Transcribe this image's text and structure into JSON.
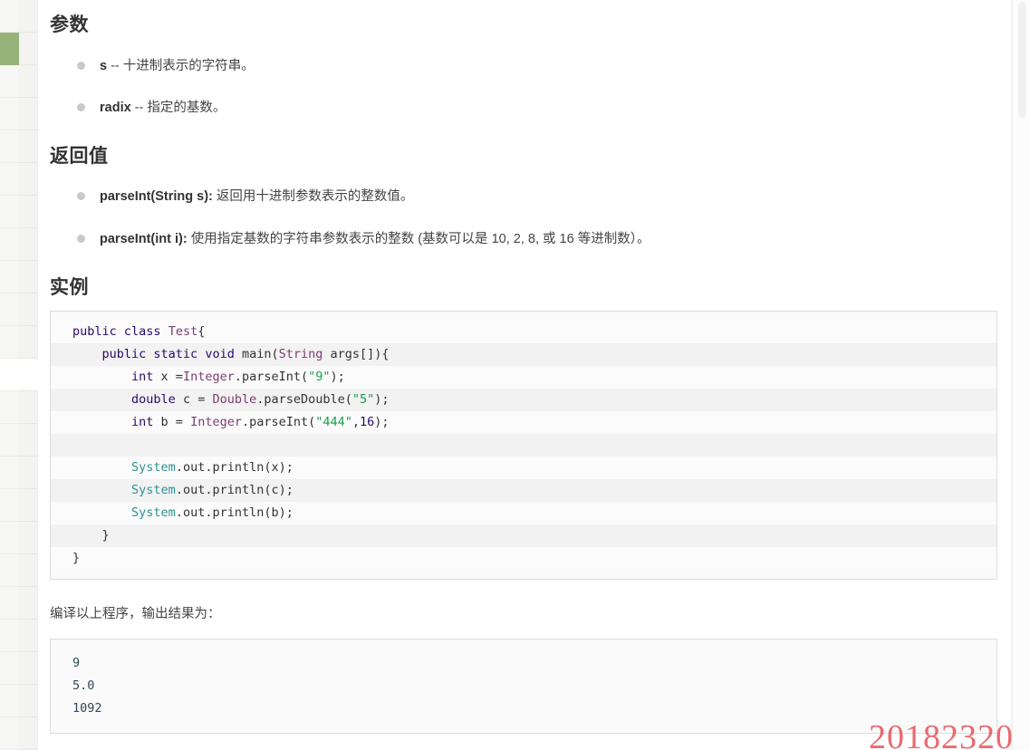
{
  "sidebar": {
    "rail_items": [
      {
        "id": "rail-0",
        "state": "normal"
      },
      {
        "id": "rail-1",
        "state": "active"
      },
      {
        "id": "rail-2",
        "state": "normal"
      },
      {
        "id": "rail-3",
        "state": "normal"
      },
      {
        "id": "rail-4",
        "state": "normal"
      },
      {
        "id": "rail-5",
        "state": "normal"
      },
      {
        "id": "rail-6",
        "state": "normal"
      },
      {
        "id": "rail-7",
        "state": "normal"
      },
      {
        "id": "rail-8",
        "state": "normal"
      },
      {
        "id": "rail-9",
        "state": "normal"
      },
      {
        "id": "rail-10",
        "state": "normal"
      },
      {
        "id": "rail-11",
        "state": "light"
      },
      {
        "id": "rail-12",
        "state": "normal"
      },
      {
        "id": "rail-13",
        "state": "normal"
      },
      {
        "id": "rail-14",
        "state": "normal"
      },
      {
        "id": "rail-15",
        "state": "normal"
      },
      {
        "id": "rail-16",
        "state": "normal"
      },
      {
        "id": "rail-17",
        "state": "normal"
      },
      {
        "id": "rail-18",
        "state": "normal"
      },
      {
        "id": "rail-19",
        "state": "normal"
      },
      {
        "id": "rail-20",
        "state": "normal"
      },
      {
        "id": "rail-21",
        "state": "normal"
      },
      {
        "id": "rail-22",
        "state": "normal"
      }
    ],
    "active_color": "#96b37a"
  },
  "sections": {
    "params": {
      "heading": "参数",
      "items": [
        {
          "term": "s",
          "desc": " -- 十进制表示的字符串。"
        },
        {
          "term": "radix",
          "desc": " -- 指定的基数。"
        }
      ]
    },
    "returns": {
      "heading": "返回值",
      "items": [
        {
          "term": "parseInt(String s):",
          "desc": " 返回用十进制参数表示的整数值。"
        },
        {
          "term": "parseInt(int i):",
          "desc": " 使用指定基数的字符串参数表示的整数 (基数可以是 10, 2, 8, 或 16 等进制数）。"
        }
      ]
    },
    "example": {
      "heading": "实例",
      "output_intro": "编译以上程序，输出结果为："
    }
  },
  "code": {
    "language": "java",
    "lines": [
      [
        {
          "t": "public ",
          "c": "kw"
        },
        {
          "t": "class ",
          "c": "kw"
        },
        {
          "t": "Test",
          "c": "cls"
        },
        {
          "t": "{",
          "c": "plain"
        }
      ],
      [
        {
          "t": "    ",
          "c": "plain"
        },
        {
          "t": "public ",
          "c": "kw"
        },
        {
          "t": "static ",
          "c": "kw"
        },
        {
          "t": "void ",
          "c": "kw"
        },
        {
          "t": "main",
          "c": "plain"
        },
        {
          "t": "(",
          "c": "plain"
        },
        {
          "t": "String ",
          "c": "cls"
        },
        {
          "t": "args[]){",
          "c": "plain"
        }
      ],
      [
        {
          "t": "        ",
          "c": "plain"
        },
        {
          "t": "int ",
          "c": "kw"
        },
        {
          "t": "x =",
          "c": "plain"
        },
        {
          "t": "Integer",
          "c": "cls"
        },
        {
          "t": ".parseInt(",
          "c": "plain"
        },
        {
          "t": "\"9\"",
          "c": "str"
        },
        {
          "t": ");",
          "c": "plain"
        }
      ],
      [
        {
          "t": "        ",
          "c": "plain"
        },
        {
          "t": "double ",
          "c": "kw"
        },
        {
          "t": "c = ",
          "c": "plain"
        },
        {
          "t": "Double",
          "c": "cls"
        },
        {
          "t": ".parseDouble(",
          "c": "plain"
        },
        {
          "t": "\"5\"",
          "c": "str"
        },
        {
          "t": ");",
          "c": "plain"
        }
      ],
      [
        {
          "t": "        ",
          "c": "plain"
        },
        {
          "t": "int ",
          "c": "kw"
        },
        {
          "t": "b = ",
          "c": "plain"
        },
        {
          "t": "Integer",
          "c": "cls"
        },
        {
          "t": ".parseInt(",
          "c": "plain"
        },
        {
          "t": "\"444\"",
          "c": "str"
        },
        {
          "t": ",",
          "c": "plain"
        },
        {
          "t": "16",
          "c": "num"
        },
        {
          "t": ");",
          "c": "plain"
        }
      ],
      [
        {
          "t": "",
          "c": "plain"
        }
      ],
      [
        {
          "t": "        ",
          "c": "plain"
        },
        {
          "t": "System",
          "c": "sys"
        },
        {
          "t": ".out.println(x);",
          "c": "plain"
        }
      ],
      [
        {
          "t": "        ",
          "c": "plain"
        },
        {
          "t": "System",
          "c": "sys"
        },
        {
          "t": ".out.println(c);",
          "c": "plain"
        }
      ],
      [
        {
          "t": "        ",
          "c": "plain"
        },
        {
          "t": "System",
          "c": "sys"
        },
        {
          "t": ".out.println(b);",
          "c": "plain"
        }
      ],
      [
        {
          "t": "    }",
          "c": "plain"
        }
      ],
      [
        {
          "t": "}",
          "c": "plain"
        }
      ]
    ]
  },
  "output": {
    "lines": [
      "9",
      "5.0",
      "1092"
    ]
  },
  "watermark": {
    "text": "20182320",
    "color": "#e8565b"
  }
}
